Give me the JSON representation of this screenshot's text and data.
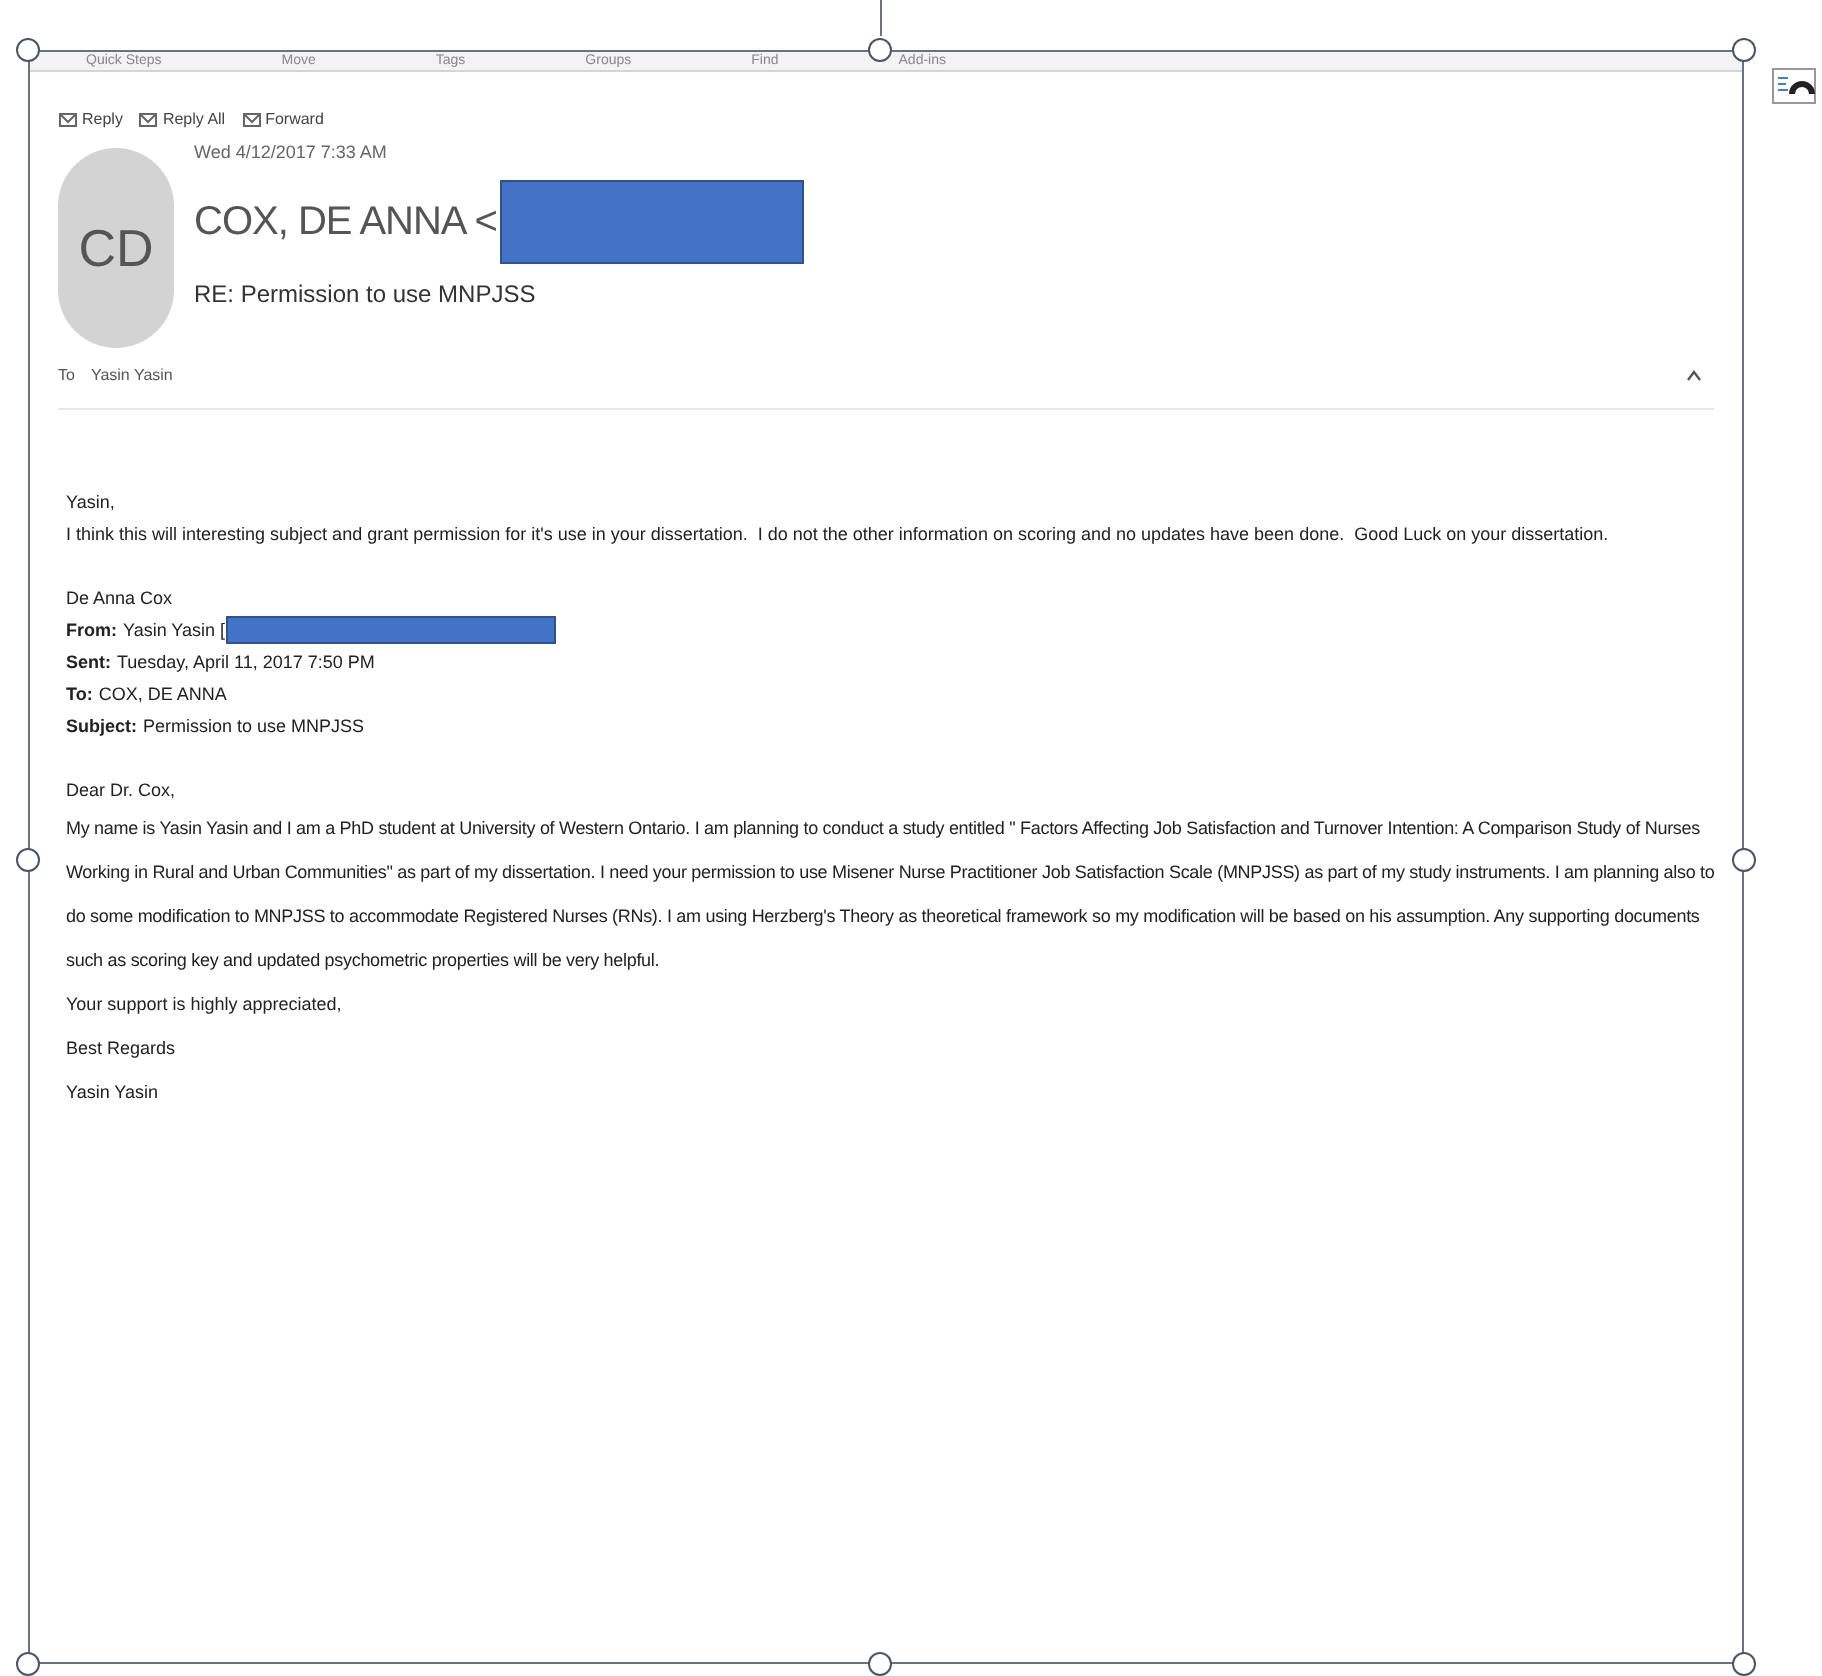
{
  "ribbon_groups": [
    "Quick Steps",
    "Move",
    "Tags",
    "Groups",
    "Find",
    "Add-ins"
  ],
  "actions": [
    "Reply",
    "Reply All",
    "Forward"
  ],
  "message": {
    "date": "Wed 4/12/2017 7:33 AM",
    "avatar_initials": "CD",
    "sender": "COX, DE ANNA <",
    "subject": "RE: Permission to use MNPJSS",
    "to_label": "To",
    "to": "Yasin Yasin"
  },
  "body": {
    "greeting": "Yasin,",
    "text": "I think this will interesting subject and grant permission for it's use in your dissertation.  I do not the other information on scoring and no updates have been done.  Good Luck on your dissertation.",
    "signature": "De Anna Cox"
  },
  "quoted_header": [
    {
      "label": "From:",
      "value": "Yasin Yasin [",
      "redacted": true
    },
    {
      "label": "Sent:",
      "value": "Tuesday, April 11, 2017 7:50 PM",
      "redacted": false
    },
    {
      "label": "To:",
      "value": "COX, DE ANNA",
      "redacted": false
    },
    {
      "label": "Subject:",
      "value": "Permission to use MNPJSS",
      "redacted": false
    }
  ],
  "quoted_body": {
    "greeting": "Dear Dr. Cox,",
    "paragraph": "My name is Yasin Yasin and I am a PhD student at University of Western Ontario. I am planning to conduct a study entitled \" Factors Affecting Job Satisfaction and Turnover Intention: A Comparison Study of Nurses Working in Rural and Urban Communities\" as part of my dissertation. I need your permission to use Misener Nurse Practitioner Job Satisfaction Scale (MNPJSS) as part of my study instruments. I am planning also to do some modification to MNPJSS to accommodate Registered Nurses (RNs). I am using Herzberg's Theory as theoretical framework so my modification will be based on his assumption. Any supporting documents such as scoring key and updated psychometric properties will be very helpful.",
    "closing": [
      "Your support is highly appreciated,",
      "Best Regards",
      "Yasin Yasin"
    ]
  }
}
